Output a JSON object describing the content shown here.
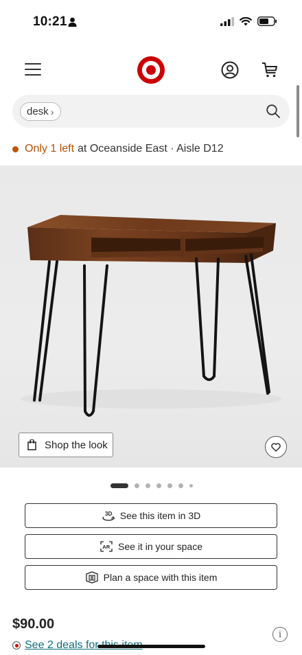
{
  "status_bar": {
    "time": "10:21"
  },
  "search": {
    "chip_label": "desk"
  },
  "stock": {
    "highlight": "Only 1 left",
    "location": "at Oceanside East · Aisle D12"
  },
  "gallery": {
    "shop_look_label": "Shop the look",
    "image_count": 7,
    "active_index": 0
  },
  "actions": {
    "view_3d_label": "See this item in 3D",
    "ar_label": "See it in your space",
    "plan_label": "Plan a space with this item"
  },
  "product": {
    "price": "$90.00",
    "deals_label": "See 2 deals for this item"
  },
  "colors": {
    "brand": "#cc0000",
    "stock_accent": "#b85000",
    "link": "#0b6e7a"
  },
  "icons": {
    "menu": "hamburger-icon",
    "logo": "target-logo",
    "account": "account-icon",
    "cart": "cart-icon",
    "search": "search-icon",
    "favorite": "heart-icon",
    "shop_look": "shopping-bag-icon",
    "view_3d": "3d-icon",
    "ar": "ar-icon",
    "plan": "plan-space-icon",
    "info": "info-icon"
  }
}
